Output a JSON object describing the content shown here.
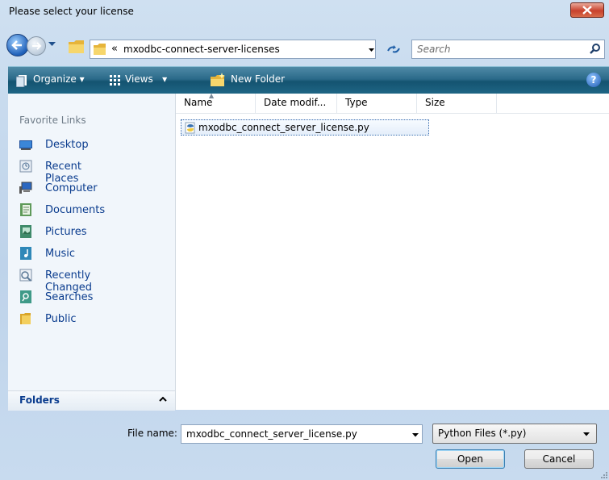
{
  "window": {
    "title": "Please select your license",
    "close": "close"
  },
  "address": {
    "separator": "«",
    "path": "mxodbc-connect-server-licenses"
  },
  "search": {
    "placeholder": "Search"
  },
  "toolbar": {
    "organize": "Organize",
    "views": "Views",
    "new_folder": "New Folder",
    "help": "?"
  },
  "favorites": {
    "title": "Favorite Links",
    "items": [
      {
        "label": "Desktop",
        "icon": "desktop-icon"
      },
      {
        "label": "Recent Places",
        "icon": "recent-places-icon"
      },
      {
        "label": "Computer",
        "icon": "computer-icon"
      },
      {
        "label": "Documents",
        "icon": "documents-icon"
      },
      {
        "label": "Pictures",
        "icon": "pictures-icon"
      },
      {
        "label": "Music",
        "icon": "music-icon"
      },
      {
        "label": "Recently Changed",
        "icon": "recently-changed-icon"
      },
      {
        "label": "Searches",
        "icon": "searches-icon"
      },
      {
        "label": "Public",
        "icon": "public-folder-icon"
      }
    ],
    "folders_label": "Folders"
  },
  "columns": [
    "Name",
    "Date modif...",
    "Type",
    "Size"
  ],
  "files": [
    {
      "name": "mxodbc_connect_server_license.py",
      "icon": "python-file-icon"
    }
  ],
  "footer": {
    "filename_label": "File name:",
    "filename_value": "mxodbc_connect_server_license.py",
    "filetype_value": "Python Files (*.py)",
    "open_label": "Open",
    "cancel_label": "Cancel"
  }
}
